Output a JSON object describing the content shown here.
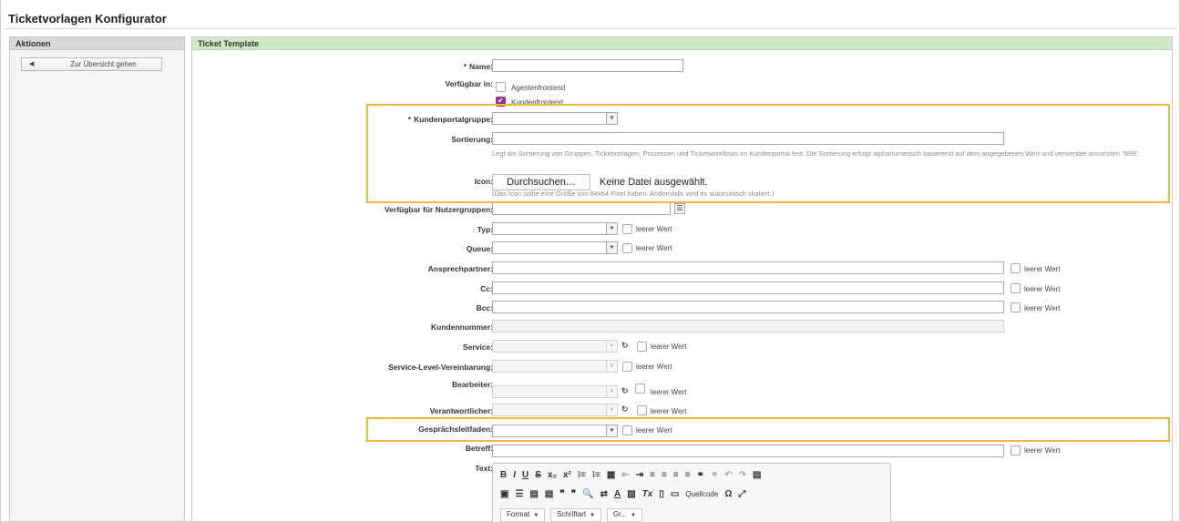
{
  "page": {
    "title": "Ticketvorlagen Konfigurator"
  },
  "sidebar": {
    "title": "Aktionen",
    "overview_button": "Zur Übersicht gehen",
    "arrow_icon": "caret-left-icon"
  },
  "main": {
    "title": "Ticket Template"
  },
  "form": {
    "name_label": "Name:",
    "name_value": "",
    "available_label": "Verfügbar in:",
    "agent_frontend": {
      "label": "Agentenfrontend",
      "checked": false
    },
    "customer_frontend": {
      "label": "Kundenfrontend",
      "checked": true
    },
    "portal_group_label": "Kundenportalgruppe:",
    "portal_group_value": "",
    "sorting_label": "Sortierung:",
    "sorting_value": "",
    "sorting_hint": "Legt die Sortierung von Gruppen, Ticketvorlagen, Prozessen und Ticketworkflows im Kundenportal fest. Die Sortierung erfolgt alphanumerisch basierend auf dem angegebenen Wert und verwendet ansonsten \"999\".",
    "icon_label": "Icon:",
    "icon_button": "Durchsuchen…",
    "icon_status": "Keine Datei ausgewählt.",
    "icon_hint": "(Das Icon sollte eine Größe von 64x64 Pixel haben. Andernfalls wird es automatisch skaliert.)",
    "usergroups_label": "Verfügbar für Nutzergruppen:",
    "type_label": "Typ:",
    "queue_label": "Queue:",
    "contact_label": "Ansprechpartner:",
    "cc_label": "Cc:",
    "bcc_label": "Bcc:",
    "customer_number_label": "Kundennummer:",
    "service_label": "Service:",
    "sla_label": "Service-Level-Vereinbarung:",
    "owner_label": "Bearbeiter:",
    "responsible_label": "Verantwortlicher:",
    "guide_label": "Gesprächsleitfaden:",
    "subject_label": "Betreff:",
    "text_label": "Text:",
    "empty_value": "leerer Wert"
  },
  "editor": {
    "row1": [
      "B",
      "I",
      "U",
      "S",
      "x₂",
      "x²",
      "⁝≡",
      "⁝≡",
      "▦",
      "⇤",
      "⇥",
      "≡",
      "≡",
      "≡",
      "≡",
      "⚭",
      "⚭",
      "↶",
      "↷",
      "▤"
    ],
    "row2": [
      "▣",
      "☰",
      "▤",
      "▤",
      "❞",
      "❞",
      "🔍",
      "⇄",
      "A",
      "▨",
      "Tx",
      "▯",
      "▭"
    ],
    "source_label": "Quellcode",
    "omega": "Ω",
    "fullscreen": "⤢",
    "format_label": "Format",
    "font_label": "Schriftart",
    "size_label": "Gr..."
  },
  "colors": {
    "highlight": "#f0b83a",
    "header_green": "#cfe8c5",
    "checkbox_checked": "#8b3a8f"
  }
}
